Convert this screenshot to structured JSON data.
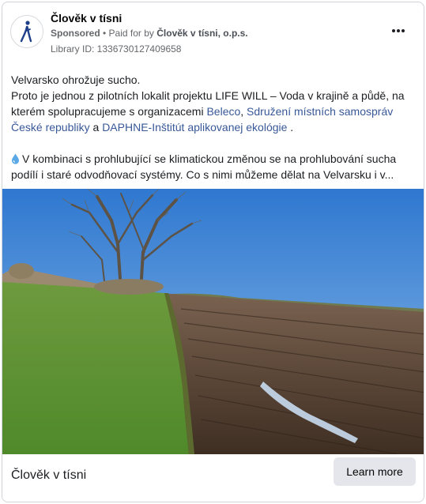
{
  "ad": {
    "page_name": "Člověk v tísni",
    "sponsored_label": "Sponsored",
    "separator": " • ",
    "paid_for_prefix": "Paid for by ",
    "payer": "Člověk v tísni, o.p.s.",
    "library_id": "Library ID: 1336730127409658"
  },
  "body": {
    "line1": "Velvarsko ohrožuje sucho.",
    "line2_text": "Proto je jednou z pilotních lokalit projektu LIFE WILL – Voda v krajině a půdě, na kterém spolupracujeme s organizacemi ",
    "link_beleco": "Beleco",
    "comma": ", ",
    "link_sdruzeni": "Sdružení místních samospráv České republiky",
    "and": " a ",
    "link_daphne": "DAPHNE-Inštitút aplikovanej ekológie",
    "period": " .",
    "paragraph2": "V kombinaci s prohlubující se klimatickou změnou se na prohlubování sucha podílí i staré odvodňovací systémy. Co s nimi můžeme dělat na Velvarsku i v...",
    "paragraph2_icon": "droplet-icon"
  },
  "footer": {
    "title": "Člověk v tísni",
    "cta_label": "Learn more"
  },
  "colors": {
    "link": "#385898",
    "cta_bg": "#e4e6eb",
    "sky": "#4f8fd6",
    "grass": "#5f9a35",
    "soil": "#5a4434"
  }
}
